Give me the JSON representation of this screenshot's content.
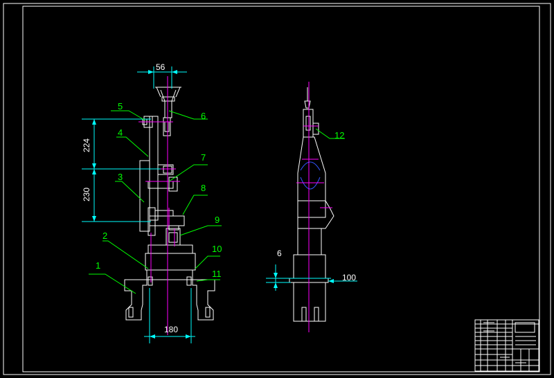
{
  "drawing": {
    "part_labels": [
      "1",
      "2",
      "3",
      "4",
      "5",
      "6",
      "7",
      "8",
      "9",
      "10",
      "11",
      "12"
    ],
    "dimensions": {
      "top_width": "56",
      "upper_height": "224",
      "lower_height": "230",
      "base_width": "180",
      "side_small": "6",
      "side_width": "100"
    }
  },
  "colors": {
    "background": "#000000",
    "outline": "#ffffff",
    "leader": "#00ff00",
    "dimension": "#00ffff",
    "centerline": "#ff00ff",
    "arc": "#3355ff"
  }
}
